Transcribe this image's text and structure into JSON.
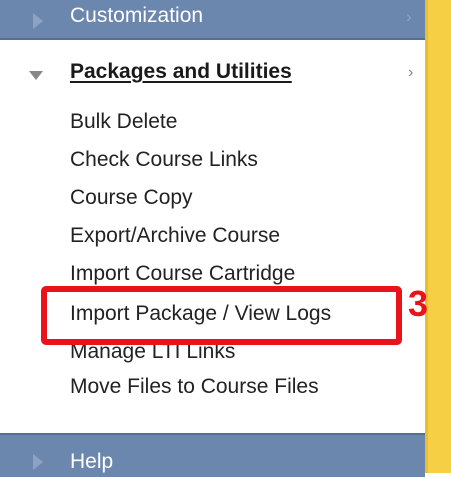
{
  "sidebar": {
    "top_section": {
      "label": "Customization",
      "chevron": "›"
    },
    "open_section": {
      "title": "Packages and Utilities",
      "chevron": "›",
      "items": [
        {
          "label": "Bulk Delete"
        },
        {
          "label": "Check Course Links"
        },
        {
          "label": "Course Copy"
        },
        {
          "label": "Export/Archive Course"
        },
        {
          "label": "Import Course Cartridge"
        },
        {
          "label": "Import Package / View Logs"
        },
        {
          "label": "Manage LTI Links"
        },
        {
          "label": "Move Files to Course Files"
        }
      ]
    },
    "bottom_section": {
      "label": "Help"
    }
  },
  "annotation": {
    "number": "3",
    "color": "#e8141a"
  },
  "colors": {
    "header_bg": "#6b87ad",
    "accent_stripe": "#f6cf45",
    "highlight": "#e8141a"
  },
  "icons": {
    "collapsed": "triangle-right-icon",
    "expanded": "triangle-down-icon",
    "chevron": "chevron-right-icon"
  }
}
